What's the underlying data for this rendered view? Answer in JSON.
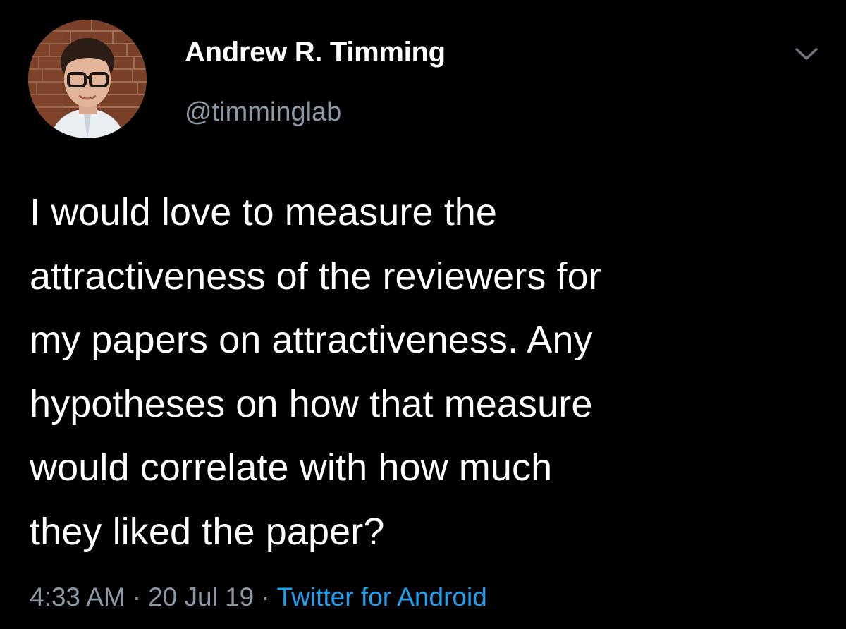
{
  "user": {
    "display_name": "Andrew R. Timming",
    "handle": "@timminglab"
  },
  "tweet": {
    "lines": [
      "I would love to measure the",
      "attractiveness of the reviewers for",
      "my papers on attractiveness. Any",
      "hypotheses on how that measure",
      "would correlate with how much",
      "they liked the paper?"
    ]
  },
  "meta": {
    "time": "4:33 AM",
    "separator": "·",
    "date": "20 Jul 19",
    "source": "Twitter for Android"
  },
  "icons": {
    "menu": "chevron-down-icon",
    "avatar": "profile-photo"
  },
  "colors": {
    "background": "#000000",
    "primary_text": "#ffffff",
    "secondary_text": "#8b98a5",
    "link": "#1da1f2"
  }
}
